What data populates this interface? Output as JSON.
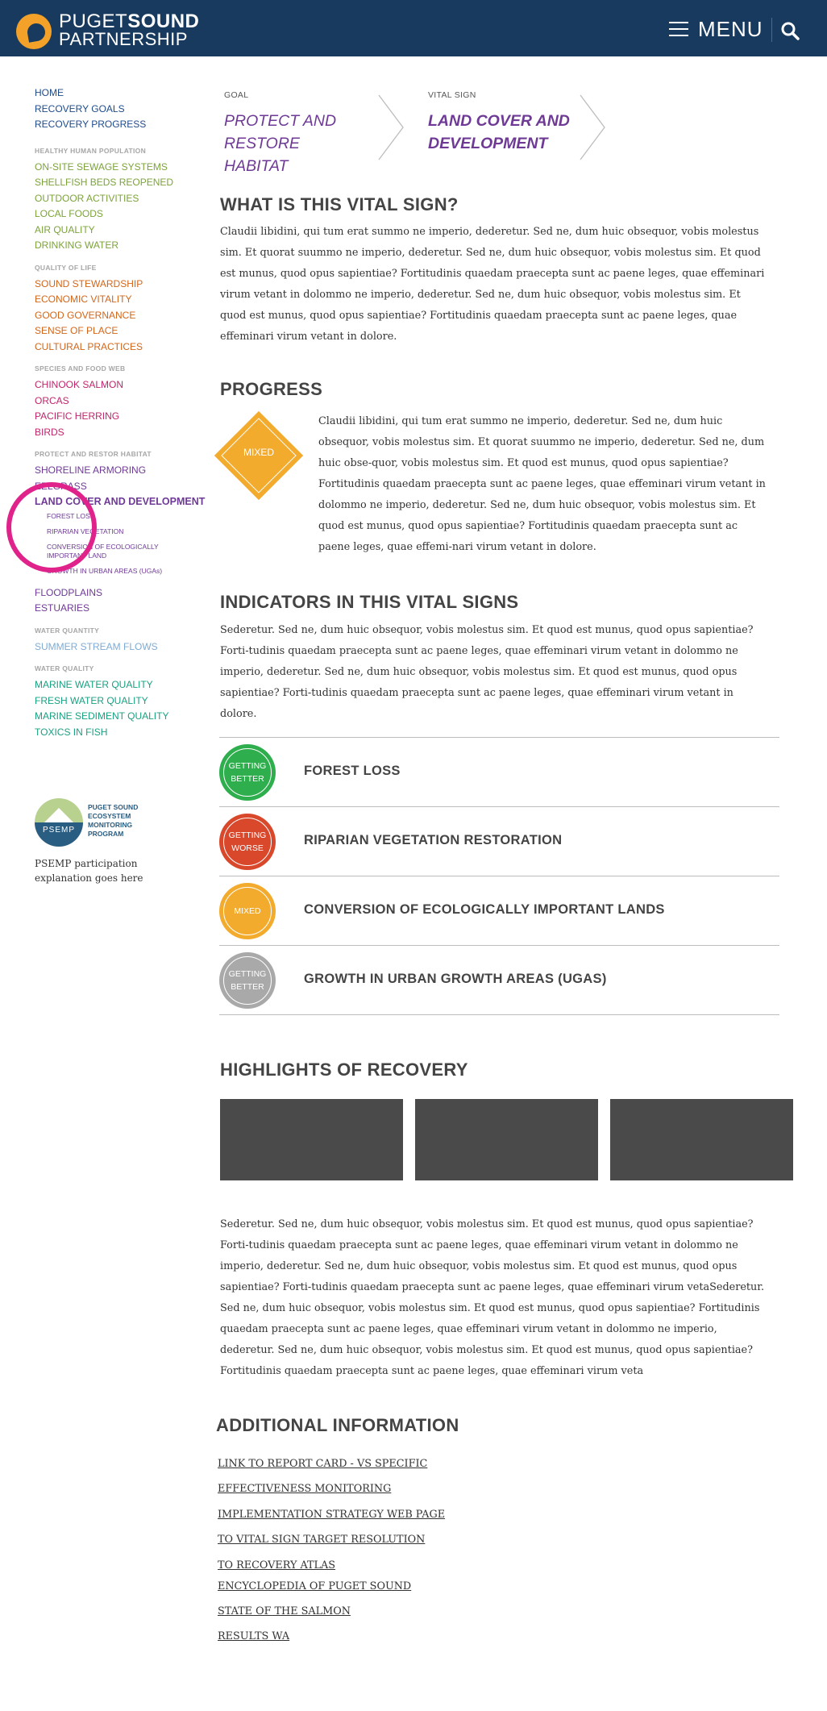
{
  "header": {
    "logo_line1_a": "PUGET",
    "logo_line1_b": "SOUND",
    "logo_line2": "PARTNERSHIP",
    "menu_label": "MENU",
    "search_icon": "search-icon",
    "menu_icon": "hamburger-icon"
  },
  "sidebar": {
    "top_links": [
      "HOME",
      "RECOVERY GOALS",
      "RECOVERY PROGRESS"
    ],
    "groups": [
      {
        "heading": "HEALTHY HUMAN POPULATION",
        "items": [
          "ON-SITE SEWAGE SYSTEMS",
          "SHELLFISH BEDS REOPENED",
          "OUTDOOR ACTIVITIES",
          "LOCAL FOODS",
          "AIR QUALITY",
          "DRINKING WATER"
        ]
      },
      {
        "heading": "QUALITY OF LIFE",
        "items": [
          "SOUND STEWARDSHIP",
          "ECONOMIC VITALITY",
          "GOOD GOVERNANCE",
          "SENSE OF PLACE",
          "CULTURAL PRACTICES"
        ]
      },
      {
        "heading": "SPECIES AND FOOD WEB",
        "items": [
          "CHINOOK SALMON",
          "ORCAS",
          "PACIFIC HERRING",
          "BIRDS"
        ]
      },
      {
        "heading": "PROTECT AND RESTOR HABITAT",
        "items": [
          "SHORELINE ARMORING",
          "EELGRASS"
        ],
        "active": "LAND COVER AND DEVELOPMENT",
        "subitems": [
          "FOREST LOSS",
          "RIPARIAN VEGETATION",
          "CONVERSION OF ECOLOGICALLY IMPORTANT LAND",
          "GROWTH IN URBAN AREAS (UGAs)"
        ],
        "after": [
          "FLOODPLAINS",
          "ESTUARIES"
        ]
      },
      {
        "heading": "WATER QUANTITY",
        "items": [
          "SUMMER STREAM FLOWS"
        ]
      },
      {
        "heading": "WATER QUALITY",
        "items": [
          "MARINE WATER QUALITY",
          "FRESH WATER QUALITY",
          "MARINE SEDIMENT QUALITY",
          "TOXICS IN FISH"
        ]
      }
    ],
    "psemp": {
      "abbr": "PSEMP",
      "name": "Puget Sound Ecosystem Monitoring Program",
      "text": "PSEMP participation explanation goes here"
    }
  },
  "breadcrumb": {
    "goal_label": "GOAL",
    "goal_title": "PROTECT AND RESTORE HABITAT",
    "vs_label": "VITAL SIGN",
    "vs_title": "LAND COVER AND DEVELOPMENT"
  },
  "what": {
    "title": "WHAT IS THIS VITAL SIGN?",
    "text": "Claudii libidini, qui tum erat summo ne imperio, dederetur. Sed ne, dum huic obsequor, vobis molestus sim. Et quorat suummo ne imperio, dederetur. Sed ne, dum huic obsequor, vobis molestus sim. Et quod est munus, quod opus sapientiae? Fortitudinis quaedam praecepta sunt ac paene leges, quae effeminari virum vetant in dolommo ne imperio, dederetur. Sed ne, dum huic obsequor, vobis molestus sim. Et quod est munus, quod opus sapientiae? Fortitudinis quaedam praecepta sunt ac paene leges, quae effeminari virum vetant in dolore."
  },
  "progress": {
    "title": "PROGRESS",
    "status": "MIXED",
    "status_color": "#f3ab2e",
    "text": "Claudii libidini, qui tum erat summo ne imperio, dederetur. Sed ne, dum huic obsequor, vobis molestus sim. Et quorat suummo ne imperio, dederetur. Sed ne, dum huic obse-quor, vobis molestus sim. Et quod est munus, quod opus sapientiae? Fortitudinis quaedam praecepta sunt ac paene leges, quae effeminari virum vetant in dolommo ne imperio, dederetur. Sed ne, dum huic obsequor, vobis molestus sim. Et quod est munus, quod opus sapientiae? Fortitudinis quaedam praecepta sunt ac paene leges, quae effemi-nari virum vetant in dolore."
  },
  "indicators": {
    "title": "INDICATORS IN THIS VITAL SIGNS",
    "text": "Sederetur. Sed ne, dum huic obsequor, vobis molestus sim. Et quod est munus, quod opus sapientiae? Forti-tudinis quaedam praecepta sunt ac paene leges, quae effeminari virum vetant in dolommo ne imperio, dederetur. Sed ne, dum huic obsequor, vobis molestus sim. Et quod est munus, quod opus sapientiae? Forti-tudinis quaedam praecepta sunt ac paene leges, quae effeminari virum vetant in dolore.",
    "rows": [
      {
        "status": "GETTING BETTER",
        "color": "#2fae4e",
        "name": "FOREST LOSS"
      },
      {
        "status": "GETTING WORSE",
        "color": "#d9482b",
        "name": "RIPARIAN VEGETATION RESTORATION"
      },
      {
        "status": "MIXED",
        "color": "#f3ab2e",
        "name": "CONVERSION OF ECOLOGICALLY IMPORTANT LANDS"
      },
      {
        "status": "GETTING BETTER",
        "color": "#a9a9a9",
        "name": "GROWTH IN URBAN GROWTH AREAS (UGAS)"
      }
    ]
  },
  "highlights": {
    "title": "HIGHLIGHTS OF RECOVERY",
    "text": "Sederetur. Sed ne, dum huic obsequor, vobis molestus sim. Et quod est munus, quod opus sapientiae? Forti-tudinis quaedam praecepta sunt ac paene leges, quae effeminari virum vetant in dolommo ne imperio, dederetur. Sed ne, dum huic obsequor, vobis molestus sim. Et quod est munus, quod opus sapientiae? Forti-tudinis quaedam praecepta sunt ac paene leges, quae effeminari virum vetaSederetur. Sed ne, dum huic obsequor, vobis molestus sim. Et quod est munus, quod opus sapientiae? Fortitudinis quaedam praecepta sunt ac paene leges, quae effeminari virum vetant in dolommo ne imperio, dederetur. Sed ne, dum huic obsequor, vobis molestus sim. Et quod est munus, quod opus sapientiae? Fortitudinis quaedam praecepta sunt ac paene leges, quae effeminari virum veta"
  },
  "additional": {
    "title": "ADDITIONAL INFORMATION",
    "links": [
      "LINK TO REPORT CARD - VS SPECIFIC",
      "EFFECTIVENESS MONITORING",
      "IMPLEMENTATION STRATEGY WEB PAGE",
      "TO VITAL SIGN TARGET RESOLUTION",
      "TO RECOVERY ATLAS",
      "ENCYCLOPEDIA OF PUGET SOUND",
      "STATE OF THE SALMON",
      "RESULTS WA"
    ]
  }
}
